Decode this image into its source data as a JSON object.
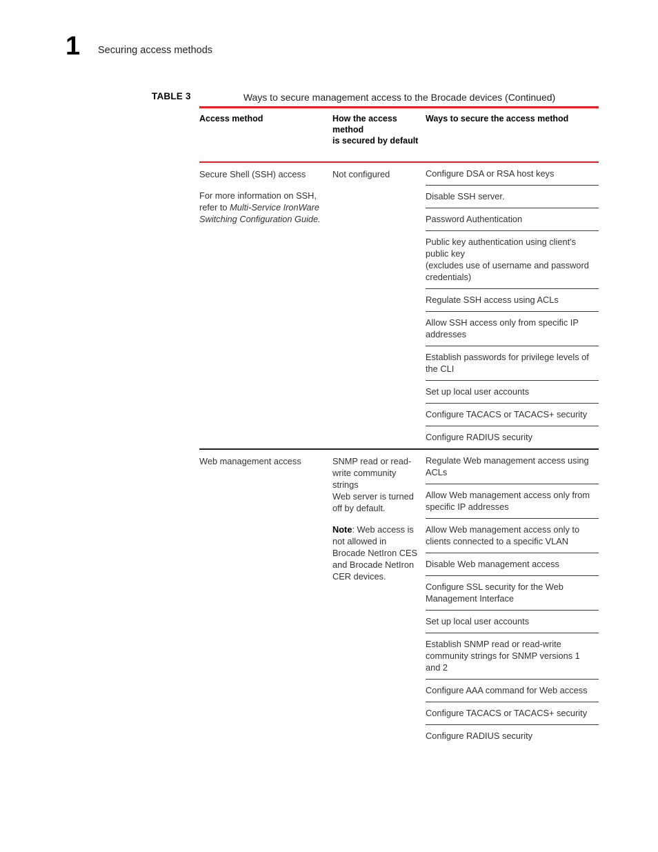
{
  "page": {
    "chapter_number": "1",
    "chapter_title": "Securing access methods"
  },
  "table": {
    "label": "TABLE 3",
    "title": "Ways to secure management access to the Brocade devices  (Continued)",
    "accent_color": "#ec1c24",
    "rule_color": "#231f20",
    "headers": {
      "col1": "Access method",
      "col2_line1": "How the access method",
      "col2_line2": "is secured by default",
      "col3": "Ways to secure the access method"
    },
    "sections": [
      {
        "access_method_line1": "Secure Shell (SSH) access",
        "access_method_para2_pre": "For more information on SSH, refer to ",
        "access_method_para2_italic": "Multi-Service IronWare Switching Configuration Guide.",
        "secured_by_default": "Not configured",
        "ways": [
          "Configure DSA or RSA host keys",
          "Disable SSH server.",
          "Password Authentication",
          "Public key authentication using client's public key\n(excludes use of username and password credentials)",
          "Regulate SSH access using ACLs",
          "Allow SSH access only from specific IP addresses",
          "Establish passwords for privilege levels of the CLI",
          "Set up local user accounts",
          "Configure TACACS or TACACS+ security",
          "Configure RADIUS security"
        ]
      },
      {
        "access_method_line1": "Web management access",
        "secured_by_default_para1": "SNMP read or read-write community strings",
        "secured_by_default_para1b": "Web server is turned off by default.",
        "secured_by_default_note_label": "Note",
        "secured_by_default_note_text": ": Web access is not allowed in Brocade NetIron CES and Brocade NetIron CER devices.",
        "ways": [
          "Regulate Web management access using ACLs",
          "Allow Web management access only from specific IP addresses",
          "Allow Web management access only to clients connected to a specific VLAN",
          "Disable Web management access",
          "Configure SSL security for the Web Management Interface",
          "Set up local user accounts",
          "Establish SNMP read or read-write community strings for SNMP versions 1 and 2",
          "Configure AAA command for Web access",
          "Configure TACACS or TACACS+ security",
          "Configure RADIUS security"
        ]
      }
    ]
  }
}
